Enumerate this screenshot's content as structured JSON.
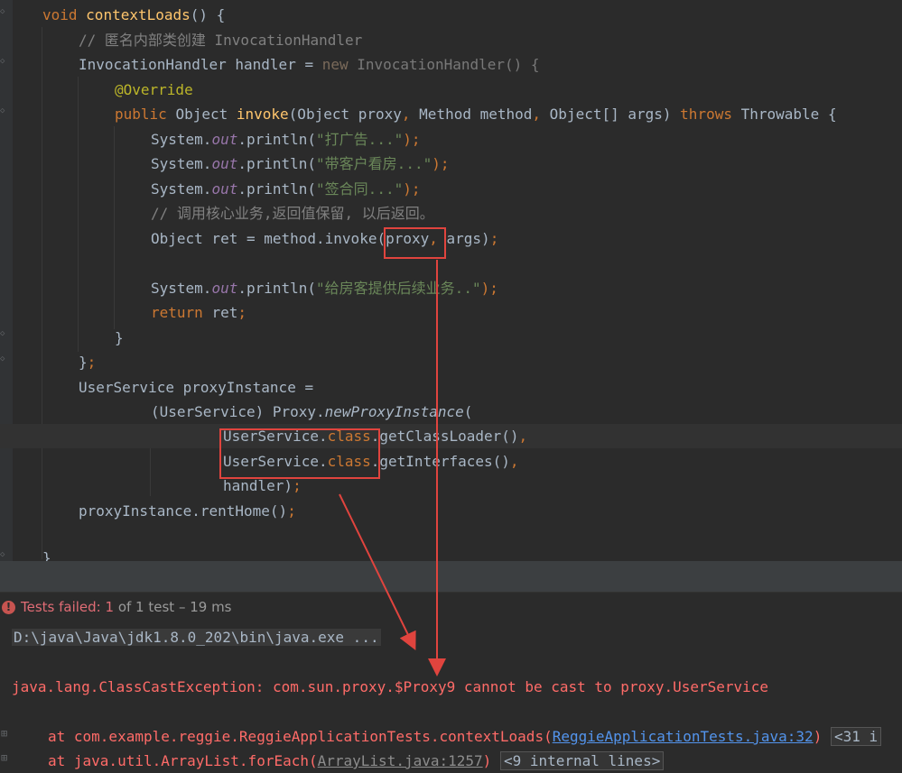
{
  "editor": {
    "lines": {
      "l1": {
        "kw": "void ",
        "fn": "contextLoads",
        "rest": "() {"
      },
      "l2": {
        "comment": "// 匿名内部类创建 InvocationHandler"
      },
      "l3": {
        "a": "InvocationHandler handler = ",
        "kw": "new ",
        "b": "InvocationHandler() {"
      },
      "l4": {
        "an": "@Override"
      },
      "l5": {
        "kw1": "public ",
        "a": "Object ",
        "fn": "invoke",
        "b": "(Object proxy",
        "c": ", ",
        "d": "Method method",
        "e": ", ",
        "f": "Object[] args) ",
        "kw2": "throws ",
        "g": "Throwable {"
      },
      "l6": {
        "a": "System.",
        "fld": "out",
        "b": ".println(",
        "str": "\"打广告...\"",
        "c": ");"
      },
      "l7": {
        "a": "System.",
        "fld": "out",
        "b": ".println(",
        "str": "\"带客户看房...\"",
        "c": ");"
      },
      "l8": {
        "a": "System.",
        "fld": "out",
        "b": ".println(",
        "str": "\"签合同...\"",
        "c": ");"
      },
      "l9": {
        "comment": "// 调用核心业务,返回值保留, 以后返回。"
      },
      "l10": {
        "a": "Object ret = method.invoke(proxy",
        "c": ", ",
        "b": "args)",
        "d": ";"
      },
      "l12": {
        "a": "System.",
        "fld": "out",
        "b": ".println(",
        "str": "\"给房客提供后续业务..\"",
        "c": ");"
      },
      "l13": {
        "kw": "return ",
        "a": "ret",
        "b": ";"
      },
      "l14": {
        "a": "}"
      },
      "l15": {
        "a": "}",
        "b": ";"
      },
      "l16": {
        "a": "UserService proxyInstance ="
      },
      "l17": {
        "a": "(UserService) Proxy.",
        "it": "newProxyInstance",
        "b": "("
      },
      "l18": {
        "a": "UserService.",
        "kw": "class",
        "b": ".getClassLoader()",
        "c": ","
      },
      "l19": {
        "a": "UserService.",
        "kw": "class",
        "b": ".getInterfaces()",
        "c": ","
      },
      "l20": {
        "a": "handler)",
        "b": ";"
      },
      "l21": {
        "a": "proxyInstance.rentHome()",
        "b": ";"
      },
      "l23": {
        "a": "}"
      }
    }
  },
  "runbar": {
    "failed_label": "Tests failed: ",
    "failed_count": "1",
    "of_text": " of 1 test – 19 ms"
  },
  "console": {
    "command": "D:\\java\\Java\\jdk1.8.0_202\\bin\\java.exe ...",
    "exception": "java.lang.ClassCastException: com.sun.proxy.$Proxy9 cannot be cast to proxy.UserService",
    "trace1": {
      "prefix": "at com.example.reggie.ReggieApplicationTests.contextLoads(",
      "link": "ReggieApplicationTests.java:32",
      "suffix": ")",
      "fold": "<31 i"
    },
    "trace2": {
      "prefix": "at java.util.ArrayList.forEach(",
      "link": "ArrayList.java:1257",
      "suffix": ")",
      "fold": "<9 internal lines>"
    }
  },
  "colors": {
    "annotation_box": "#e0443e",
    "error_text": "#ff6b68",
    "link": "#5394ec"
  }
}
